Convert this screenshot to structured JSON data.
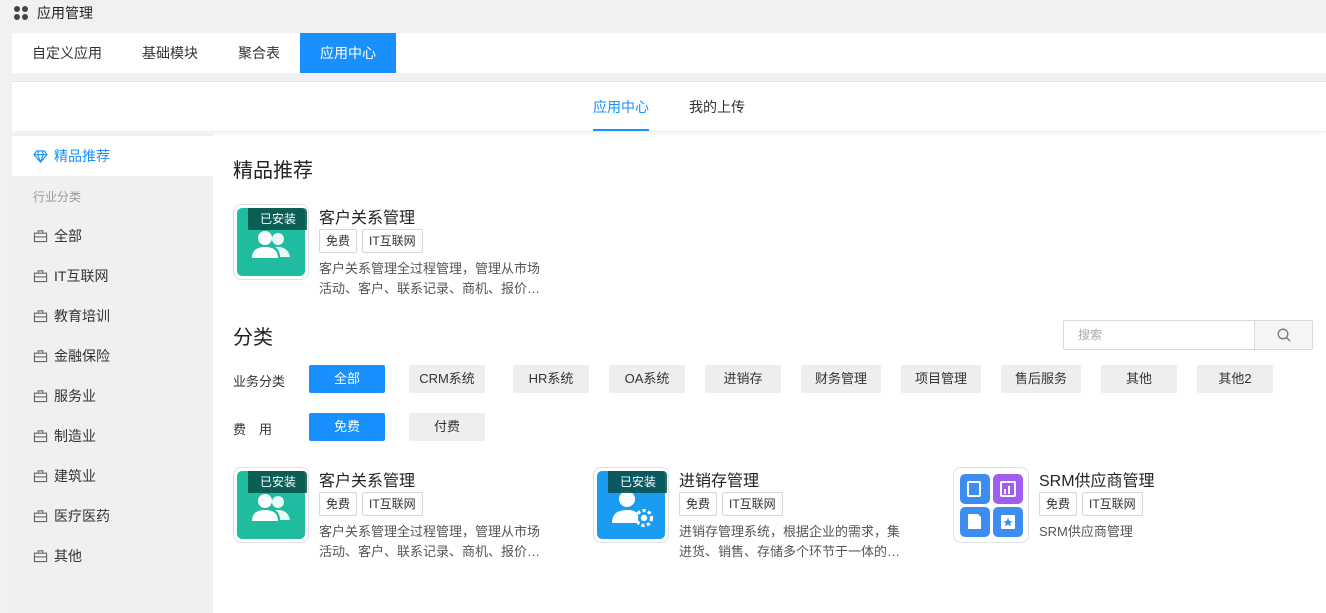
{
  "app": {
    "title": "应用管理"
  },
  "main_tabs": [
    "自定义应用",
    "基础模块",
    "聚合表",
    "应用中心"
  ],
  "sub_tabs": [
    "应用中心",
    "我的上传"
  ],
  "sidebar": {
    "featured": "精品推荐",
    "group_label": "行业分类",
    "items": [
      "全部",
      "IT互联网",
      "教育培训",
      "金融保险",
      "服务业",
      "制造业",
      "建筑业",
      "医疗医药",
      "其他"
    ]
  },
  "featured": {
    "title": "精品推荐",
    "card": {
      "name": "客户关系管理",
      "badge": "已安装",
      "tags": [
        "免费",
        "IT互联网"
      ],
      "desc_line1": "客户关系管理全过程管理，管理从市场",
      "desc_line2": "活动、客户、联系记录、商机、报价…",
      "icon": "people-icon",
      "color": "#1fbc9f"
    }
  },
  "category": {
    "title": "分类",
    "search_placeholder": "搜索",
    "business_label": "业务分类",
    "business_options": [
      "全部",
      "CRM系统",
      "HR系统",
      "OA系统",
      "进销存",
      "财务管理",
      "项目管理",
      "售后服务",
      "其他",
      "其他2"
    ],
    "fee_label": "费　用",
    "fee_options": [
      "免费",
      "付费"
    ]
  },
  "apps": [
    {
      "name": "客户关系管理",
      "badge": "已安装",
      "tags": [
        "免费",
        "IT互联网"
      ],
      "desc_line1": "客户关系管理全过程管理，管理从市场",
      "desc_line2": "活动、客户、联系记录、商机、报价…",
      "icon": "people-icon",
      "color": "#1fbc9f"
    },
    {
      "name": "进销存管理",
      "badge": "已安装",
      "tags": [
        "免费",
        "IT互联网"
      ],
      "desc_line1": "进销存管理系统，根据企业的需求，集",
      "desc_line2": "进货、销售、存储多个环节于一体的…",
      "icon": "user-gear-icon",
      "color": "#1a9df0"
    },
    {
      "name": "SRM供应商管理",
      "badge": "",
      "tags": [
        "免费",
        "IT互联网"
      ],
      "desc_line1": "SRM供应商管理",
      "desc_line2": "",
      "icon": "app-grid-icon",
      "color": "#ffffff"
    }
  ],
  "colors": {
    "accent": "#1890ff",
    "sidebar_bg": "#f0f0f0",
    "badge_bg": "#0a4e46"
  }
}
